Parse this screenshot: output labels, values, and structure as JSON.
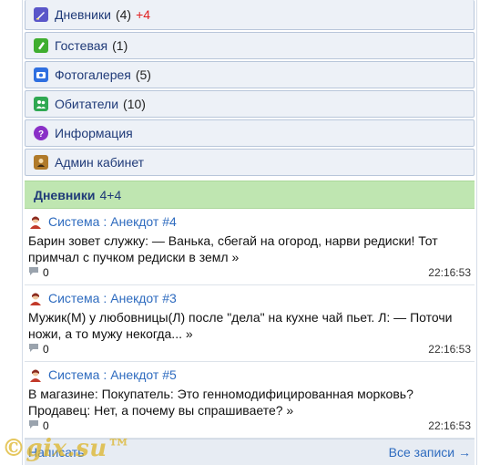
{
  "menu": {
    "items": [
      {
        "label": "Дневники",
        "count": "(4)",
        "plus": "+4",
        "icon": "diary-icon",
        "color": "#5a56c9"
      },
      {
        "label": "Гостевая",
        "count": "(1)",
        "icon": "guestbook-icon",
        "color": "#3fae2f"
      },
      {
        "label": "Фотогалерея",
        "count": "(5)",
        "icon": "camera-icon",
        "color": "#2f6fe0"
      },
      {
        "label": "Обитатели",
        "count": "(10)",
        "icon": "users-icon",
        "color": "#2fa852"
      },
      {
        "label": "Информация",
        "icon": "question-icon",
        "color": "#8a2fc7"
      },
      {
        "label": "Админ кабинет",
        "icon": "admin-icon",
        "color": "#b07a2a"
      }
    ]
  },
  "section": {
    "title": "Дневники",
    "count": "4+4"
  },
  "posts": [
    {
      "author": "Система",
      "title": "Анекдот #4",
      "body": "Барин зовет служку: — Ванька, сбегай на огород, нарви редиски! Тот примчал с пучком редиски в земл »",
      "comments": "0",
      "time": "22:16:53"
    },
    {
      "author": "Система",
      "title": "Анекдот #3",
      "body": "Мужик(М) у любовницы(Л) после \"дела\" на кухне чай пьет. Л: — Поточи ножи, а то мужу некогда... »",
      "comments": "0",
      "time": "22:16:53"
    },
    {
      "author": "Система",
      "title": "Анекдот #5",
      "body": "В магазине: Покупатель: Это генномодифицированная морковь? Продавец: Нет, а почему вы спрашиваете? »",
      "comments": "0",
      "time": "22:16:53"
    }
  ],
  "footer": {
    "write": "Написать",
    "all": "Все записи →"
  },
  "watermark": "©gix.su™"
}
